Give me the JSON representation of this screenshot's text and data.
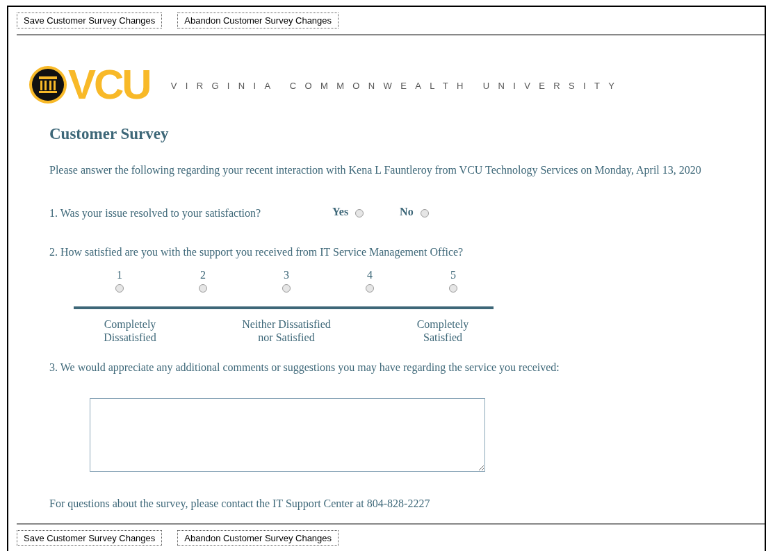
{
  "top_buttons": [
    {
      "label": "Save Customer Survey Changes"
    },
    {
      "label": "Abandon Customer Survey Changes"
    }
  ],
  "logo": {
    "text": "VCU",
    "university_name": "VIRGINIA COMMONWEALTH UNIVERSITY"
  },
  "survey": {
    "title": "Customer Survey",
    "intro": "Please answer the following regarding your recent interaction with Kena L Fauntleroy from VCU Technology Services on Monday, April 13, 2020",
    "questions": [
      {
        "kind": "yesno",
        "text": "1. Was your issue resolved to your satisfaction?",
        "options": [
          {
            "label": "Yes",
            "selected": false
          },
          {
            "label": "No",
            "selected": false
          }
        ]
      },
      {
        "kind": "scale",
        "text": "2. How satisfied are you with the support you received from IT Service Management Office?",
        "options": [
          {
            "label": "1",
            "selected": false
          },
          {
            "label": "2",
            "selected": false
          },
          {
            "label": "3",
            "selected": false
          },
          {
            "label": "4",
            "selected": false
          },
          {
            "label": "5",
            "selected": false
          }
        ],
        "anchors": [
          "Completely Dissatisfied",
          "Neither Dissatisfied nor Satisfied",
          "Completely Satisfied"
        ]
      },
      {
        "kind": "comment",
        "text": "3. We would appreciate any additional comments or suggestions you may have regarding the service you received:"
      }
    ],
    "footer": "For questions about the survey, please contact the IT Support Center at 804-828-2227"
  },
  "bottom_buttons": [
    {
      "label": "Save Customer Survey Changes"
    },
    {
      "label": "Abandon Customer Survey Changes"
    }
  ]
}
